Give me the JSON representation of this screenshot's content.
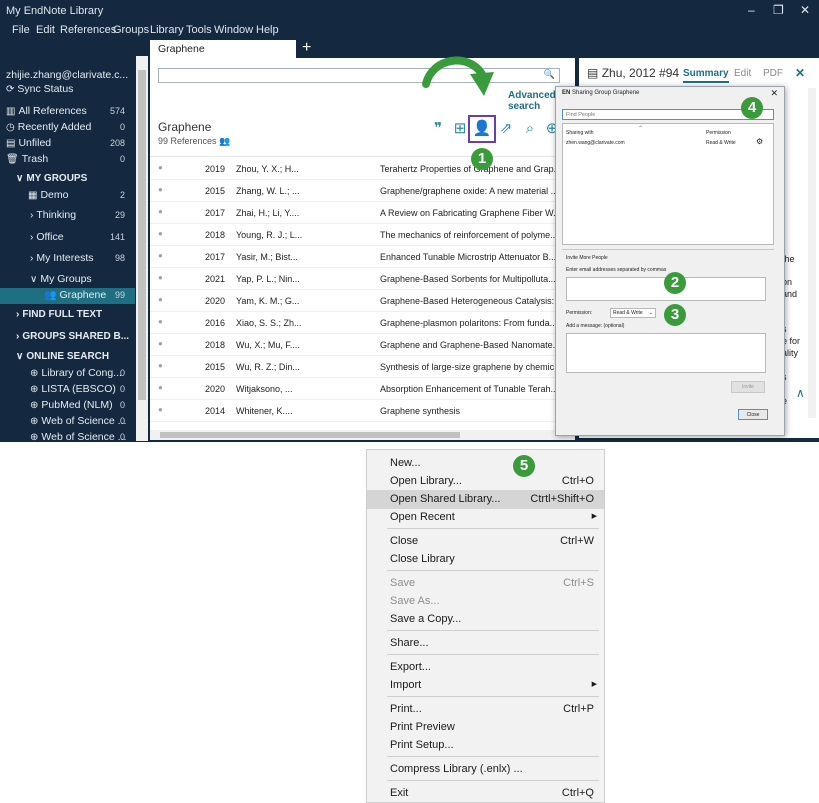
{
  "window": {
    "title": "My EndNote Library",
    "minimize": "–",
    "restore": "❐",
    "close": "✕"
  },
  "menubar": [
    "File",
    "Edit",
    "References",
    "Groups",
    "Library",
    "Tools",
    "Window",
    "Help"
  ],
  "sidebar": {
    "account": "zhijie.zhang@clarivate.c...",
    "sync": "Sync Status",
    "items": [
      {
        "label": "All References",
        "count": "574",
        "icon": "books-icon"
      },
      {
        "label": "Recently Added",
        "count": "0",
        "icon": "clock-icon"
      },
      {
        "label": "Unfiled",
        "count": "208",
        "icon": "file-icon"
      },
      {
        "label": "Trash",
        "count": "0",
        "icon": "trash-icon"
      }
    ],
    "my_groups_header": "MY GROUPS",
    "groups": [
      {
        "label": "Demo",
        "count": "2"
      },
      {
        "label": "Thinking",
        "count": "29"
      },
      {
        "label": "Office",
        "count": "141"
      },
      {
        "label": "My Interests",
        "count": "98"
      },
      {
        "label": "My Groups",
        "count": ""
      },
      {
        "label": "Graphene",
        "count": "99"
      }
    ],
    "find_full_text": "FIND FULL TEXT",
    "groups_shared": "GROUPS SHARED B...",
    "online_search": "ONLINE SEARCH",
    "online": [
      {
        "label": "Library of Cong...",
        "count": "0"
      },
      {
        "label": "LISTA (EBSCO)",
        "count": "0"
      },
      {
        "label": "PubMed (NLM)",
        "count": "0"
      },
      {
        "label": "Web of Science ...",
        "count": "0"
      },
      {
        "label": "Web of Science ...",
        "count": "0"
      }
    ]
  },
  "library_tab": {
    "label": "Graphene",
    "plus": "+"
  },
  "main": {
    "advanced_search": "Advanced search",
    "title": "Graphene",
    "count": "99 References",
    "rows": [
      {
        "year": "2019",
        "author": "Zhou, Y. X.; H...",
        "title": "Terahertz Properties of Graphene and Grap..."
      },
      {
        "year": "2015",
        "author": "Zhang, W. L.; ...",
        "title": "Graphene/graphene oxide: A new material ..."
      },
      {
        "year": "2017",
        "author": "Zhai, H.; Li, Y....",
        "title": "A Review on Fabricating Graphene Fiber W..."
      },
      {
        "year": "2018",
        "author": "Young, R. J.; L...",
        "title": "The mechanics of reinforcement of polyme..."
      },
      {
        "year": "2017",
        "author": "Yasir, M.; Bist...",
        "title": "Enhanced Tunable Microstrip Attenuator B..."
      },
      {
        "year": "2021",
        "author": "Yap, P. L.; Nin...",
        "title": "Graphene-Based Sorbents for Multipolluta..."
      },
      {
        "year": "2020",
        "author": "Yam, K. M.; G...",
        "title": "Graphene-Based Heterogeneous Catalysis: ..."
      },
      {
        "year": "2016",
        "author": "Xiao, S. S.; Zh...",
        "title": "Graphene-plasmon polaritons: From funda..."
      },
      {
        "year": "2018",
        "author": "Wu, X.; Mu, F....",
        "title": "Graphene and Graphene-Based Nanomate..."
      },
      {
        "year": "2015",
        "author": "Wu, R. Z.; Din...",
        "title": "Synthesis of large-size graphene by chemic..."
      },
      {
        "year": "2020",
        "author": "Witjaksono, ...",
        "title": "Absorption Enhancement of Tunable Terah..."
      },
      {
        "year": "2014",
        "author": "Whitener, K....",
        "title": "Graphene synthesis"
      }
    ]
  },
  "reference": {
    "heading": "Zhu, 2012 #94",
    "tabs": [
      "Summary",
      "Edit",
      "PDF"
    ],
    "close": "✕",
    "fragments": [
      "l",
      "the",
      "f",
      "on",
      "and",
      "s",
      "e for",
      "ality",
      "s",
      "e"
    ]
  },
  "dialog": {
    "title": "Sharing Group Graphene",
    "close": "✕",
    "find_placeholder": "Find People",
    "sharing_with": "Sharing with",
    "permission_header": "Permission",
    "member_email": "zhen.wang@clarivate.com",
    "member_permission": "Read & Write",
    "invite_header": "Invite More People",
    "email_hint": "Enter email addresses separated by commas",
    "permission_label": "Permission:",
    "permission_value": "Read & Write",
    "message_label": "Add a message: (optional)",
    "invite_button": "Invite",
    "close_button": "Close"
  },
  "badges": [
    "1",
    "2",
    "3",
    "4",
    "5"
  ],
  "file_menu": {
    "items": [
      {
        "label": "New...",
        "shortcut": ""
      },
      {
        "label": "Open Library...",
        "shortcut": "Ctrl+O"
      },
      {
        "label": "Open Shared Library...",
        "shortcut": "Ctrtl+Shift+O"
      },
      {
        "label": "Open Recent",
        "shortcut": ""
      },
      {
        "label": "Close",
        "shortcut": "Ctrl+W"
      },
      {
        "label": "Close Library",
        "shortcut": ""
      },
      {
        "label": "Save",
        "shortcut": "Ctrl+S"
      },
      {
        "label": "Save As...",
        "shortcut": ""
      },
      {
        "label": "Save a Copy...",
        "shortcut": ""
      },
      {
        "label": "Share...",
        "shortcut": ""
      },
      {
        "label": "Export...",
        "shortcut": ""
      },
      {
        "label": "Import",
        "shortcut": ""
      },
      {
        "label": "Print...",
        "shortcut": "Ctrl+P"
      },
      {
        "label": "Print Preview",
        "shortcut": ""
      },
      {
        "label": "Print Setup...",
        "shortcut": ""
      },
      {
        "label": "Compress Library (.enlx) ...",
        "shortcut": ""
      },
      {
        "label": "Exit",
        "shortcut": "Ctrl+Q"
      }
    ]
  },
  "colors": {
    "sidebar_bg": "#14293f",
    "accent": "#1f6f82",
    "badge": "#3a9b3c",
    "highlight_box": "#6b3fa8"
  }
}
